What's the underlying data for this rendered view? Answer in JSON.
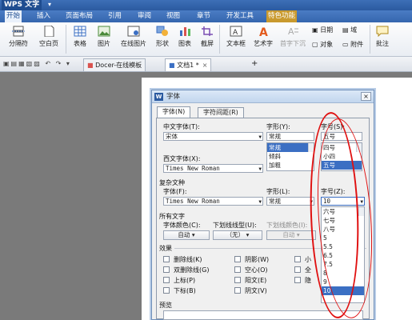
{
  "app": {
    "title": "WPS 文字"
  },
  "menu": {
    "tabs": [
      "开始",
      "插入",
      "页面布局",
      "引用",
      "审阅",
      "视图",
      "章节",
      "开发工具",
      "特色功能"
    ]
  },
  "ribbon": {
    "big": [
      "分隔符",
      "空白页",
      "表格",
      "图片",
      "在线图片",
      "形状",
      "图表",
      "截屏",
      "文本框",
      "艺术字",
      "首字下沉",
      "批注"
    ],
    "small": [
      "日期",
      "域",
      "对象",
      "附件"
    ]
  },
  "doctabs": {
    "template": "Docer-在线模板",
    "doc": "文档1 *",
    "add": "+"
  },
  "dialog": {
    "title": "字体",
    "tabs": [
      "字体(N)",
      "字符间距(R)"
    ],
    "cn_font_label": "中文字体(T):",
    "cn_font_value": "宋体",
    "style_label": "字形(Y):",
    "style_value": "常规",
    "style_list": [
      "常规",
      "倾斜",
      "加粗"
    ],
    "size_label": "字号(S):",
    "size_value": "五号",
    "size_list": [
      "四号",
      "小四",
      "五号"
    ],
    "west_font_label": "西文字体(X):",
    "west_font_value": "Times New Roman",
    "complex_title": "复杂文种",
    "cfont_label": "字体(F):",
    "cfont_value": "Times New Roman",
    "cstyle_label": "字形(L):",
    "cstyle_value": "常规",
    "csize_label": "字号(Z):",
    "csize_value": "10",
    "csize_list": [
      "六号",
      "七号",
      "八号",
      "5",
      "5.5",
      "6.5",
      "7.5",
      "8",
      "9",
      "10"
    ],
    "all_title": "所有文字",
    "color_label": "字体颜色(C):",
    "color_value": "自动",
    "uline_label": "下划线线型(U):",
    "uline_value": "（无）",
    "ucolor_label": "下划线颜色(I):",
    "ucolor_value": "自动",
    "effects_title": "效果",
    "effects": [
      "删除线(K)",
      "双删除线(G)",
      "上标(P)",
      "下标(B)",
      "阴影(W)",
      "空心(O)",
      "阳文(E)",
      "阴文(V)",
      "小",
      "全",
      "隐"
    ],
    "preview_title": "预览"
  },
  "colors": {
    "annotation": "#e01010",
    "titlebar": "#2b5aa0"
  }
}
